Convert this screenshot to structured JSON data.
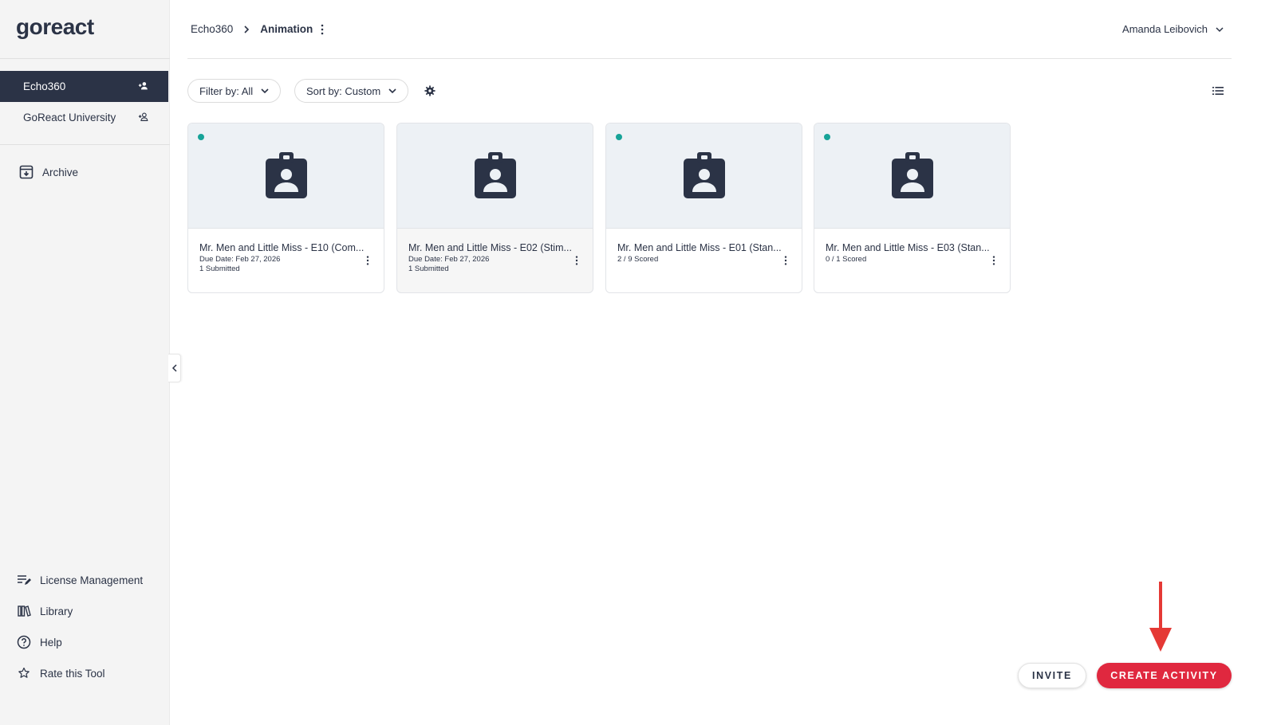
{
  "sidebar": {
    "logo": {
      "part1": "go",
      "part2": "react"
    },
    "groups": [
      {
        "label": "Echo360",
        "active": true
      },
      {
        "label": "GoReact University",
        "active": false
      }
    ],
    "archive_label": "Archive",
    "bottom_items": [
      {
        "label": "License Management",
        "icon": "license-icon"
      },
      {
        "label": "Library",
        "icon": "library-icon"
      },
      {
        "label": "Help",
        "icon": "help-icon"
      },
      {
        "label": "Rate this Tool",
        "icon": "star-icon"
      }
    ]
  },
  "header": {
    "breadcrumb_parent": "Echo360",
    "breadcrumb_current": "Animation",
    "user_name": "Amanda Leibovich"
  },
  "toolbar": {
    "filter_label": "Filter by: All",
    "sort_label": "Sort by: Custom"
  },
  "cards": [
    {
      "title": "Mr. Men and Little Miss - E10 (Com...",
      "line1": "Due Date: Feb 27, 2026",
      "line2": "1 Submitted",
      "dot": true
    },
    {
      "title": "Mr. Men and Little Miss - E02 (Stim...",
      "line1": "Due Date: Feb 27, 2026",
      "line2": "1 Submitted",
      "dot": false
    },
    {
      "title": "Mr. Men and Little Miss - E01 (Stan...",
      "line1": "2 / 9 Scored",
      "line2": "",
      "dot": true
    },
    {
      "title": "Mr. Men and Little Miss - E03 (Stan...",
      "line1": "0 / 1 Scored",
      "line2": "",
      "dot": true
    }
  ],
  "buttons": {
    "invite": "INVITE",
    "create_activity": "CREATE ACTIVITY"
  },
  "colors": {
    "navy": "#2b3346",
    "accent_red": "#e0283f",
    "teal_dot": "#17a398",
    "thumb_bg": "#edf1f5"
  }
}
